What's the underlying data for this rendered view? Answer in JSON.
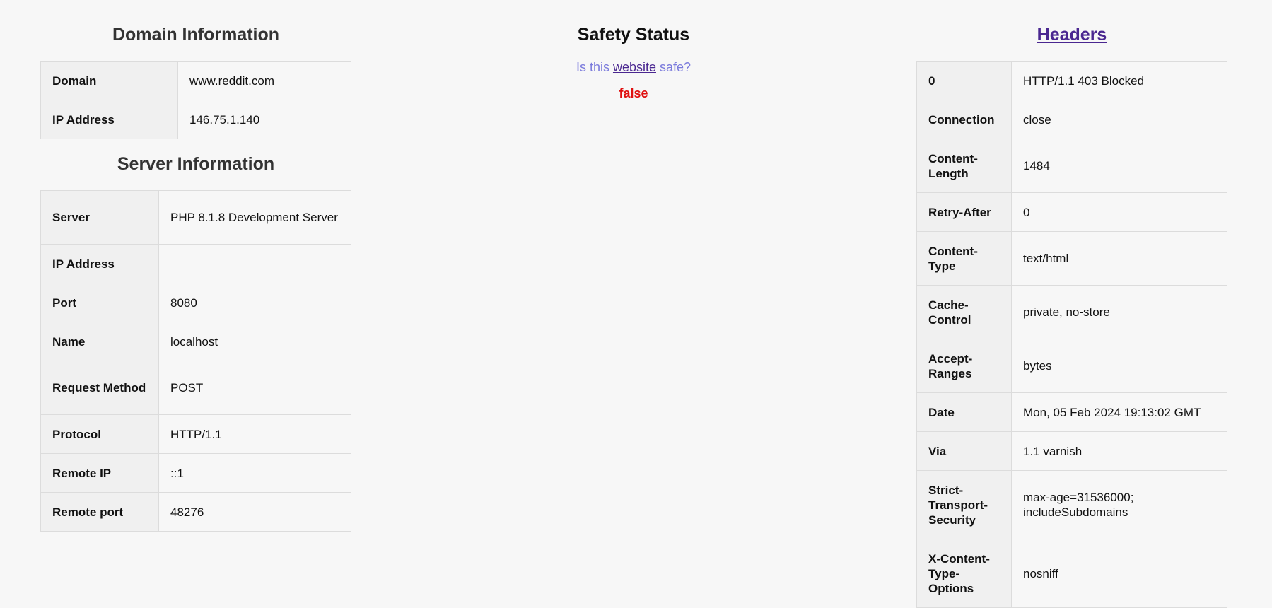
{
  "domain_section": {
    "title": "Domain Information",
    "rows": [
      {
        "key": "Domain",
        "value": "www.reddit.com"
      },
      {
        "key": "IP Address",
        "value": "146.75.1.140"
      }
    ]
  },
  "server_section": {
    "title": "Server Information",
    "rows": [
      {
        "key": "Server",
        "value": "PHP 8.1.8 Development Server"
      },
      {
        "key": "IP Address",
        "value": ""
      },
      {
        "key": "Port",
        "value": "8080"
      },
      {
        "key": "Name",
        "value": "localhost"
      },
      {
        "key": "Request Method",
        "value": "POST"
      },
      {
        "key": "Protocol",
        "value": "HTTP/1.1"
      },
      {
        "key": "Remote IP",
        "value": "::1"
      },
      {
        "key": "Remote port",
        "value": "48276"
      }
    ]
  },
  "safety_section": {
    "title": "Safety Status",
    "question_prefix": "Is this ",
    "question_link": "website",
    "question_suffix": " safe?",
    "value": "false"
  },
  "headers_section": {
    "title": "Headers",
    "rows": [
      {
        "key": "0",
        "value": "HTTP/1.1 403 Blocked"
      },
      {
        "key": "Connection",
        "value": "close"
      },
      {
        "key": "Content-Length",
        "value": "1484"
      },
      {
        "key": "Retry-After",
        "value": "0"
      },
      {
        "key": "Content-Type",
        "value": "text/html"
      },
      {
        "key": "Cache-Control",
        "value": "private, no-store"
      },
      {
        "key": "Accept-Ranges",
        "value": "bytes"
      },
      {
        "key": "Date",
        "value": "Mon, 05 Feb 2024 19:13:02 GMT"
      },
      {
        "key": "Via",
        "value": "1.1 varnish"
      },
      {
        "key": "Strict-Transport-Security",
        "value": "max-age=31536000; includeSubdomains"
      },
      {
        "key": "X-Content-Type-Options",
        "value": "nosniff"
      }
    ]
  },
  "colors": {
    "background": "#f7f7f7",
    "key_cell": "#f0f0f0",
    "border": "#dcdcdc",
    "link": "#4a2790",
    "question_text": "#7b7bdc",
    "unsafe_value": "#e01010"
  }
}
